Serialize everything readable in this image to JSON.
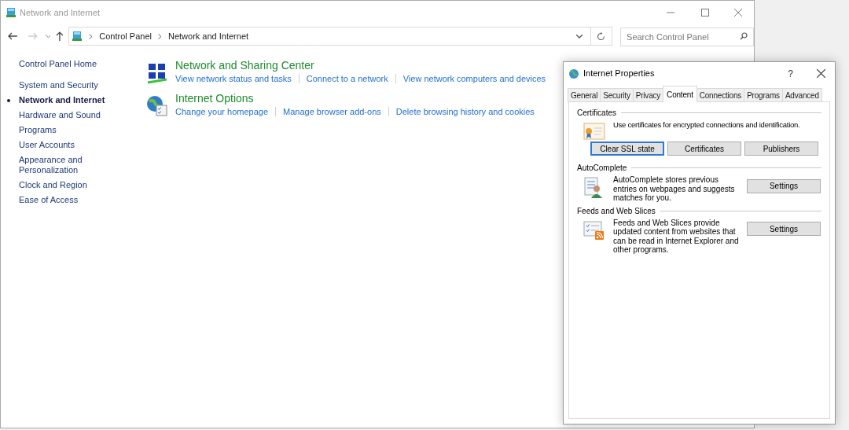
{
  "window": {
    "title": "Network and Internet"
  },
  "address_bar": {
    "breadcrumb": [
      "Control Panel",
      "Network and Internet"
    ]
  },
  "search": {
    "placeholder": "Search Control Panel"
  },
  "sidebar": {
    "items": [
      {
        "label": "Control Panel Home",
        "selected": false
      },
      {
        "label": "System and Security",
        "selected": false
      },
      {
        "label": "Network and Internet",
        "selected": true
      },
      {
        "label": "Hardware and Sound",
        "selected": false
      },
      {
        "label": "Programs",
        "selected": false
      },
      {
        "label": "User Accounts",
        "selected": false
      },
      {
        "label": "Appearance and Personalization",
        "selected": false
      },
      {
        "label": "Clock and Region",
        "selected": false
      },
      {
        "label": "Ease of Access",
        "selected": false
      }
    ]
  },
  "categories": [
    {
      "kind": "network",
      "title": "Network and Sharing Center",
      "links": [
        "View network status and tasks",
        "Connect to a network",
        "View network computers and devices"
      ]
    },
    {
      "kind": "internet",
      "title": "Internet Options",
      "links": [
        "Change your homepage",
        "Manage browser add-ons",
        "Delete browsing history and cookies"
      ]
    }
  ],
  "dialog": {
    "title": "Internet Properties",
    "help": "?",
    "tabs": [
      {
        "label": "General",
        "selected": false
      },
      {
        "label": "Security",
        "selected": false
      },
      {
        "label": "Privacy",
        "selected": false
      },
      {
        "label": "Content",
        "selected": true
      },
      {
        "label": "Connections",
        "selected": false
      },
      {
        "label": "Programs",
        "selected": false
      },
      {
        "label": "Advanced",
        "selected": false
      }
    ],
    "sections": [
      {
        "kind": "certificates",
        "title": "Certificates",
        "text": "Use certificates for encrypted connections and identification.",
        "buttons": [
          {
            "label": "Clear SSL state",
            "focused": true
          },
          {
            "label": "Certificates",
            "focused": false
          },
          {
            "label": "Publishers",
            "focused": false
          }
        ]
      },
      {
        "kind": "autocomplete",
        "title": "AutoComplete",
        "text": "AutoComplete stores previous entries on webpages and suggests matches for you.",
        "buttons": [
          {
            "label": "Settings",
            "focused": false
          }
        ]
      },
      {
        "kind": "feeds",
        "title": "Feeds and Web Slices",
        "text": "Feeds and Web Slices provide updated content from websites that can be read in Internet Explorer and other programs.",
        "buttons": [
          {
            "label": "Settings",
            "focused": false
          }
        ]
      }
    ]
  }
}
